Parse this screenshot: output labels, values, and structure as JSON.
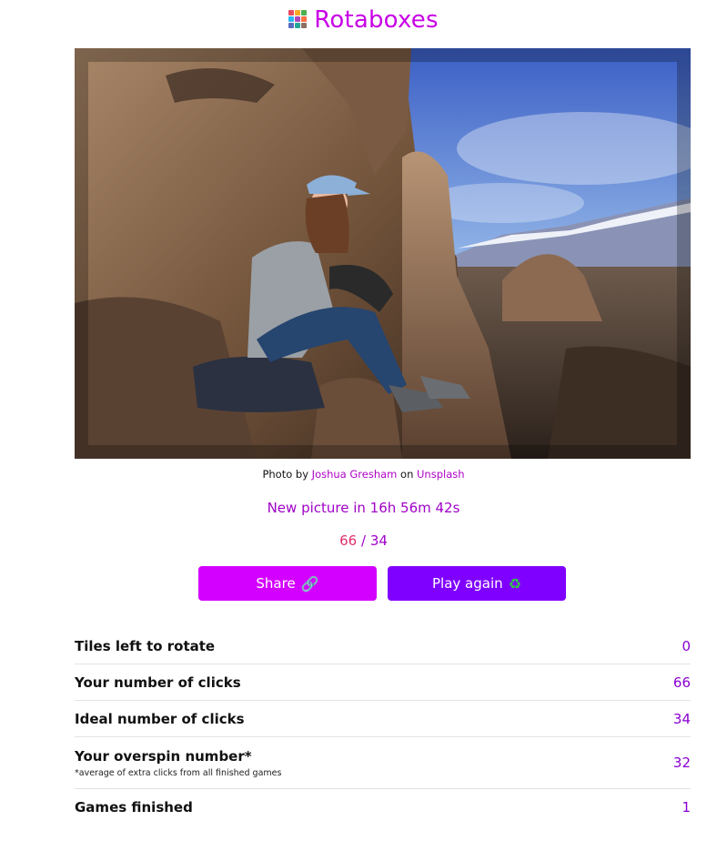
{
  "header": {
    "title": "Rotaboxes",
    "logo_colors": [
      "#e84a5f",
      "#f9a825",
      "#4caf50",
      "#29b6f6",
      "#ab47bc",
      "#ff7043",
      "#5c6bc0",
      "#26a69a",
      "#8d6e63"
    ]
  },
  "photo": {
    "credit_prefix": "Photo by",
    "author": "Joshua Gresham",
    "credit_middle": "on",
    "source": "Unsplash"
  },
  "countdown": "New picture in 16h 56m 42s",
  "score": {
    "clicks": "66",
    "separator": "/",
    "ideal": "34"
  },
  "buttons": {
    "share_label": "Share",
    "share_icon": "🔗",
    "play_label": "Play again",
    "play_icon": "♻"
  },
  "stats": [
    {
      "label": "Tiles left to rotate",
      "note": "",
      "value": "0"
    },
    {
      "label": "Your number of clicks",
      "note": "",
      "value": "66"
    },
    {
      "label": "Ideal number of clicks",
      "note": "",
      "value": "34"
    },
    {
      "label": "Your overspin number*",
      "note": "*average of extra clicks from all finished games",
      "value": "32"
    },
    {
      "label": "Games finished",
      "note": "",
      "value": "1"
    }
  ]
}
